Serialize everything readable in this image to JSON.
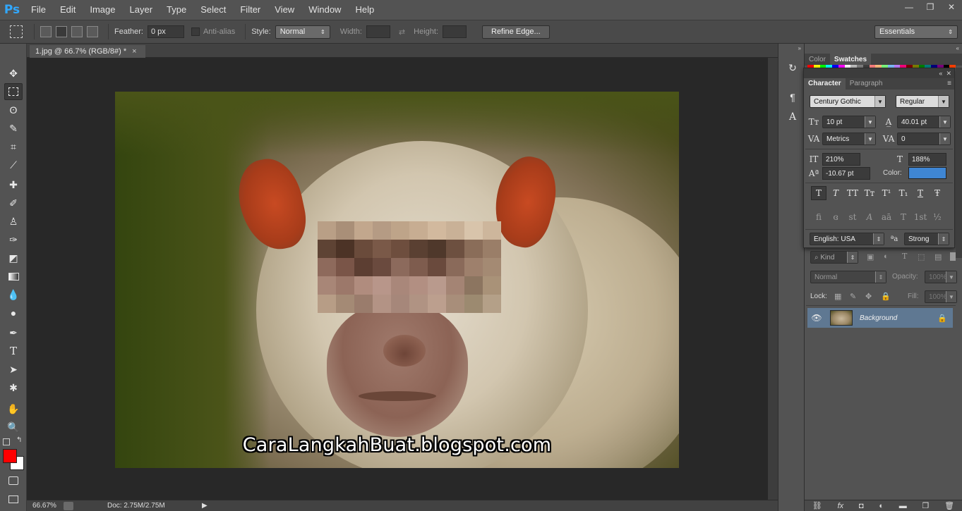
{
  "app": {
    "logo": "Ps",
    "menu": [
      "File",
      "Edit",
      "Image",
      "Layer",
      "Type",
      "Select",
      "Filter",
      "View",
      "Window",
      "Help"
    ],
    "window_controls": [
      "—",
      "❐",
      "✕"
    ]
  },
  "options": {
    "feather_label": "Feather:",
    "feather_value": "0 px",
    "antialias_label": "Anti-alias",
    "style_label": "Style:",
    "style_value": "Normal",
    "width_label": "Width:",
    "height_label": "Height:",
    "refine_edge": "Refine Edge...",
    "workspace": "Essentials"
  },
  "document": {
    "tab_title": "1.jpg @ 66.7% (RGB/8#) *",
    "tab_close": "×",
    "watermark": "CaraLangkahBuat.blogspot.com"
  },
  "status": {
    "zoom": "66.67%",
    "doc": "Doc: 2.75M/2.75M"
  },
  "panels": {
    "top_tabs": [
      "Color",
      "Swatches"
    ],
    "swatch_colors": [
      "#ff0000",
      "#ffff00",
      "#00ff00",
      "#00ffff",
      "#0000ff",
      "#ff00ff",
      "#ffffff",
      "#c0c0c0",
      "#808080",
      "#404040",
      "#ff8080",
      "#ffc080",
      "#80ff80",
      "#80c0ff",
      "#c080ff",
      "#ff0080",
      "#800000",
      "#808000",
      "#008000",
      "#008080",
      "#000080",
      "#800080",
      "#000000",
      "#ff4000"
    ],
    "character_tabs": [
      "Character",
      "Paragraph"
    ],
    "font_family": "Century Gothic",
    "font_style": "Regular",
    "font_size": "10 pt",
    "leading": "40.01 pt",
    "kerning": "Metrics",
    "tracking": "0",
    "vertical_scale": "210%",
    "horizontal_scale": "188%",
    "baseline_shift": "-10.67 pt",
    "color_label": "Color:",
    "text_color": "#3f86d3",
    "style_buttons": [
      "T",
      "T",
      "TT",
      "Tт",
      "T¹",
      "T₁",
      "T",
      "Ŧ"
    ],
    "opentype_buttons": [
      "fi",
      "ɞ",
      "st",
      "A",
      "aā",
      "T",
      "1st",
      "½"
    ],
    "language": "English: USA",
    "aa_icon": "ªa",
    "antialias": "Strong"
  },
  "layers": {
    "kind": "Kind",
    "blend_mode": "Normal",
    "opacity_label": "Opacity:",
    "opacity_value": "100%",
    "lock_label": "Lock:",
    "fill_label": "Fill:",
    "fill_value": "100%",
    "layer_name": "Background",
    "bottom_icons": [
      "⛓",
      "fx",
      "◘",
      "◐",
      "▬",
      "❐",
      "🗑"
    ]
  },
  "colors": {
    "foreground": "#ff0000",
    "background": "#ffffff",
    "layer_selected": "#5f7892"
  }
}
